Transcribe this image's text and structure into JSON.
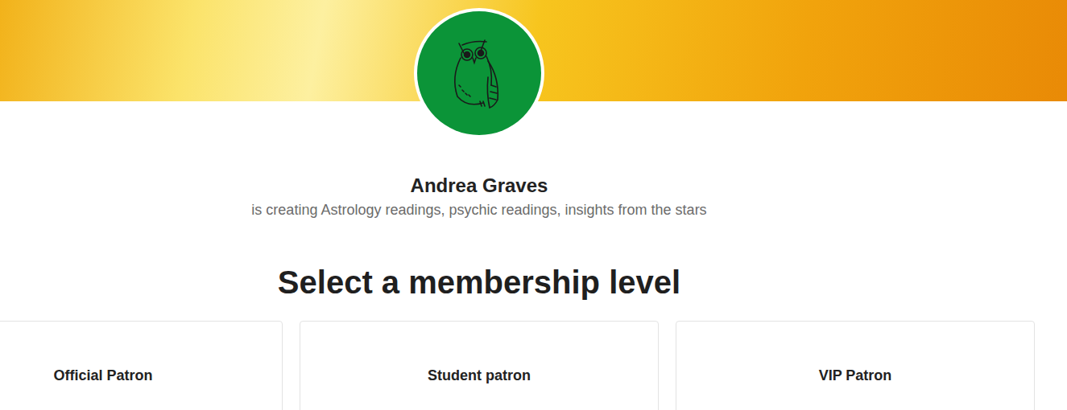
{
  "creator": {
    "name": "Andrea Graves",
    "tagline": "is creating Astrology readings, psychic readings, insights from the stars"
  },
  "heading": "Select a membership level",
  "tiers": [
    {
      "name": "Official Patron"
    },
    {
      "name": "Student patron"
    },
    {
      "name": "VIP Patron"
    }
  ]
}
